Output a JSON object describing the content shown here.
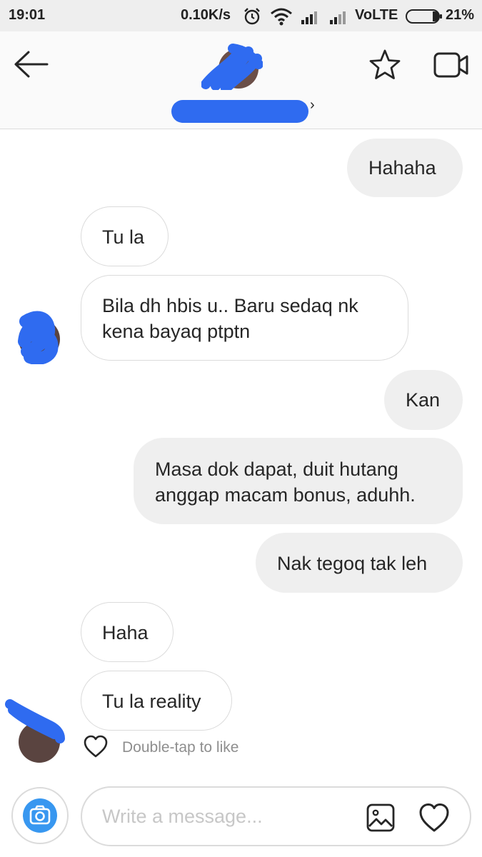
{
  "status_bar": {
    "time": "19:01",
    "speed": "0.10K/s",
    "network": "VoLTE",
    "battery": "21%"
  },
  "header": {
    "back_icon": "arrow-left-icon",
    "star_icon": "star-icon",
    "video_icon": "video-camera-icon",
    "chevron": "›"
  },
  "messages": [
    {
      "direction": "sent",
      "text": "Hahaha"
    },
    {
      "direction": "received",
      "text": "Tu la"
    },
    {
      "direction": "received",
      "lines": [
        "Bila dh hbis u.. Baru sedaq nk",
        "kena bayaq ptptn"
      ]
    },
    {
      "direction": "sent",
      "text": "Kan"
    },
    {
      "direction": "sent",
      "lines": [
        "Masa dok dapat, duit hutang",
        "anggap macam bonus, aduhh."
      ]
    },
    {
      "direction": "sent",
      "text": "Nak tegoq tak leh"
    },
    {
      "direction": "received",
      "text": "Haha"
    },
    {
      "direction": "received",
      "text": "Tu la reality"
    }
  ],
  "like_hint": "Double-tap to like",
  "composer": {
    "placeholder": "Write a message...",
    "value": ""
  },
  "colors": {
    "redaction": "#2f6bf0",
    "sent_bubble": "#efefef",
    "received_border": "#dbdbdb",
    "camera_button": "#3897f0"
  }
}
